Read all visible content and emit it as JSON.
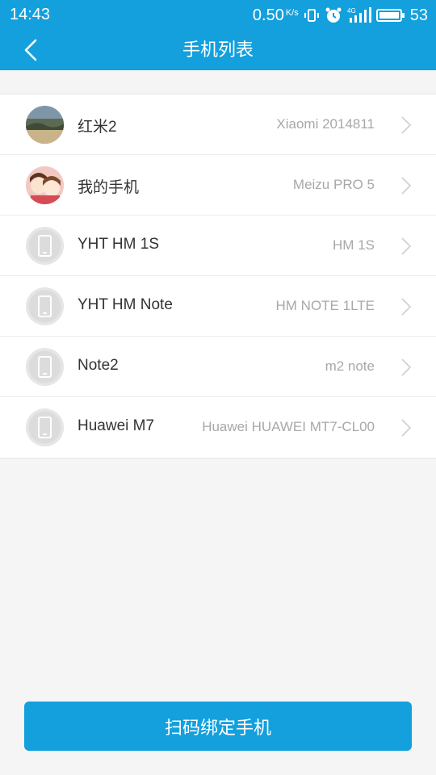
{
  "status_bar": {
    "time": "14:43",
    "net_speed": "0.50",
    "net_unit": "K/s",
    "signal_label": "4G",
    "battery": "53"
  },
  "header": {
    "title": "手机列表",
    "back_icon": "chevron-left-icon"
  },
  "devices": [
    {
      "name": "红米2",
      "model": "Xiaomi 2014811",
      "avatar": "photo-landscape"
    },
    {
      "name": "我的手机",
      "model": "Meizu PRO 5",
      "avatar": "photo-cartoon"
    },
    {
      "name": "YHT HM 1S",
      "model": "HM 1S",
      "avatar": "phone-icon"
    },
    {
      "name": "YHT HM Note",
      "model": "HM NOTE 1LTE",
      "avatar": "phone-icon"
    },
    {
      "name": "Note2",
      "model": "m2 note",
      "avatar": "phone-icon"
    },
    {
      "name": "Huawei M7",
      "model": "Huawei HUAWEI MT7-CL00",
      "avatar": "phone-icon"
    }
  ],
  "bind_button": {
    "label": "扫码绑定手机"
  },
  "colors": {
    "accent": "#13a0dd",
    "background": "#f5f5f5",
    "muted_text": "#a8a8a8"
  }
}
